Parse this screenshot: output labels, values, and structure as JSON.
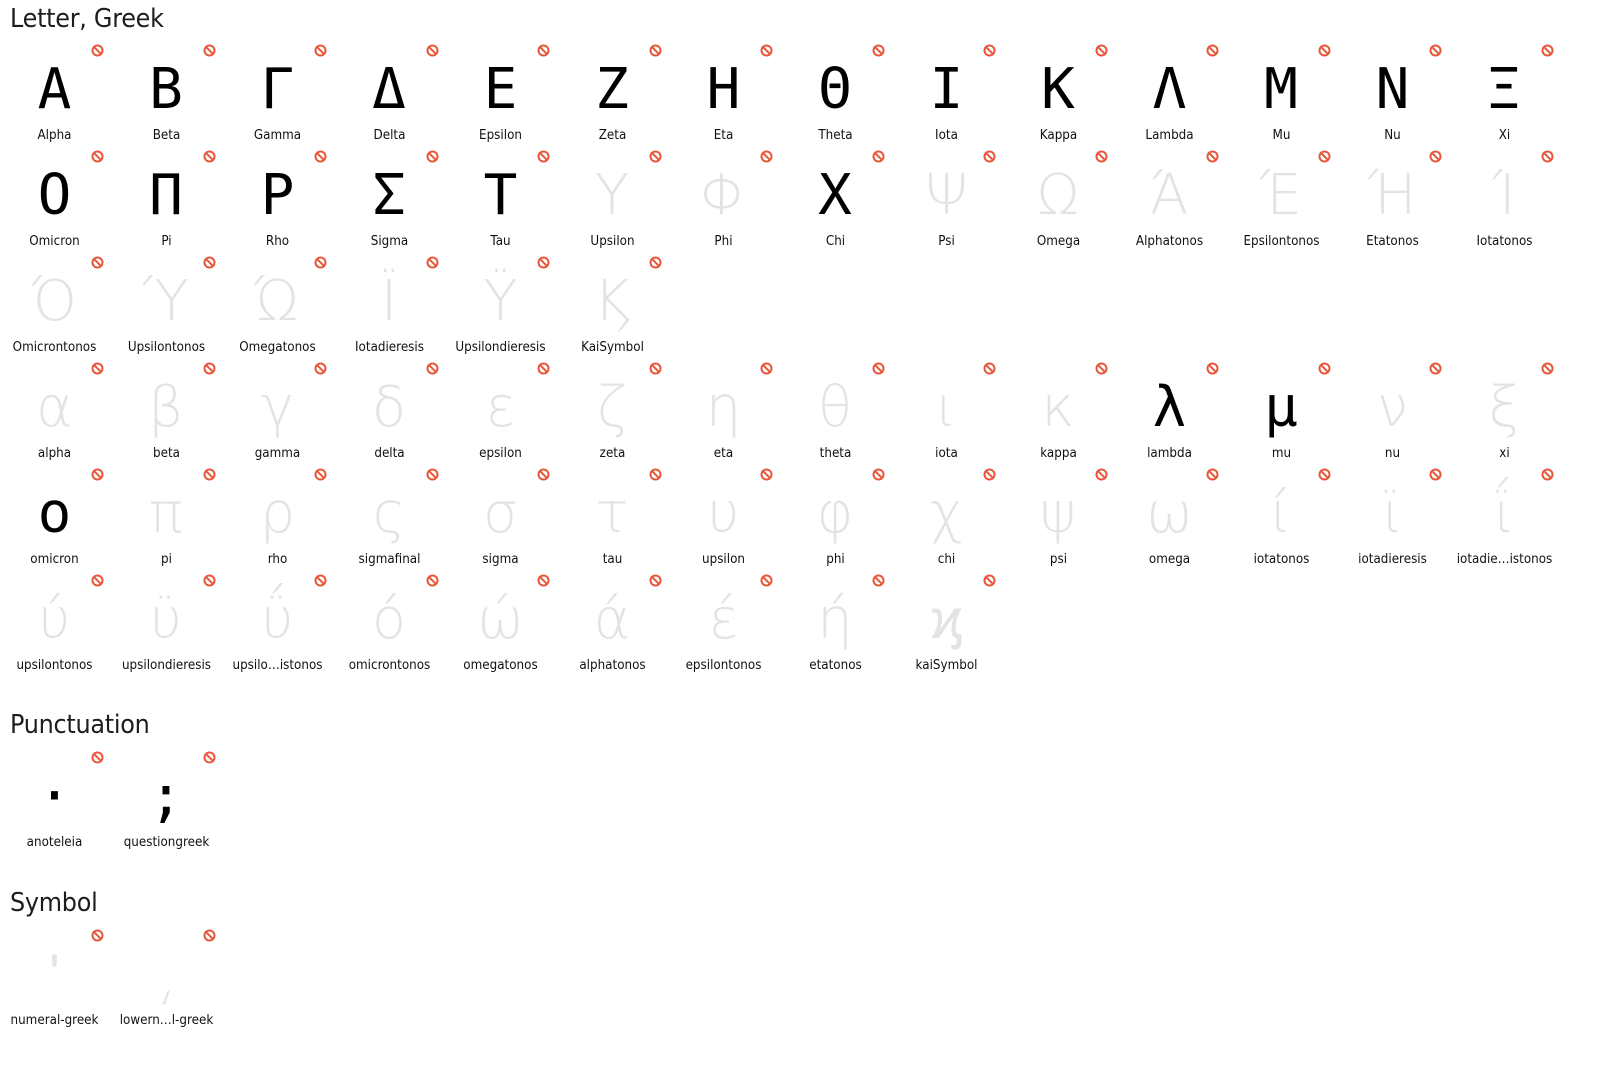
{
  "colors": {
    "missing_glyph": "#e3e3e3",
    "present_glyph": "#000000",
    "no_entry_icon": "#e8563a"
  },
  "sections": [
    {
      "title": "Letter, Greek",
      "items": [
        {
          "char": "Α",
          "name": "Alpha",
          "present": true
        },
        {
          "char": "Β",
          "name": "Beta",
          "present": true
        },
        {
          "char": "Γ",
          "name": "Gamma",
          "present": true
        },
        {
          "char": "Δ",
          "name": "Delta",
          "present": true
        },
        {
          "char": "Ε",
          "name": "Epsilon",
          "present": true
        },
        {
          "char": "Ζ",
          "name": "Zeta",
          "present": true
        },
        {
          "char": "Η",
          "name": "Eta",
          "present": true
        },
        {
          "char": "Θ",
          "name": "Theta",
          "present": true
        },
        {
          "char": "Ι",
          "name": "Iota",
          "present": true
        },
        {
          "char": "Κ",
          "name": "Kappa",
          "present": true
        },
        {
          "char": "Λ",
          "name": "Lambda",
          "present": true
        },
        {
          "char": "Μ",
          "name": "Mu",
          "present": true
        },
        {
          "char": "Ν",
          "name": "Nu",
          "present": true
        },
        {
          "char": "Ξ",
          "name": "Xi",
          "present": true
        },
        {
          "char": "Ο",
          "name": "Omicron",
          "present": true
        },
        {
          "char": "Π",
          "name": "Pi",
          "present": true
        },
        {
          "char": "Ρ",
          "name": "Rho",
          "present": true
        },
        {
          "char": "Σ",
          "name": "Sigma",
          "present": true
        },
        {
          "char": "Τ",
          "name": "Tau",
          "present": true
        },
        {
          "char": "Υ",
          "name": "Upsilon",
          "present": false
        },
        {
          "char": "Φ",
          "name": "Phi",
          "present": false
        },
        {
          "char": "Χ",
          "name": "Chi",
          "present": true
        },
        {
          "char": "Ψ",
          "name": "Psi",
          "present": false
        },
        {
          "char": "Ω",
          "name": "Omega",
          "present": false
        },
        {
          "char": "Ά",
          "name": "Alphatonos",
          "present": false
        },
        {
          "char": "Έ",
          "name": "Epsilontonos",
          "present": false
        },
        {
          "char": "Ή",
          "name": "Etatonos",
          "present": false
        },
        {
          "char": "Ί",
          "name": "Iotatonos",
          "present": false
        },
        {
          "char": "Ό",
          "name": "Omicrontonos",
          "present": false
        },
        {
          "char": "Ύ",
          "name": "Upsilontonos",
          "present": false
        },
        {
          "char": "Ώ",
          "name": "Omegatonos",
          "present": false
        },
        {
          "char": "Ϊ",
          "name": "Iotadieresis",
          "present": false
        },
        {
          "char": "Ϋ",
          "name": "Upsilondieresis",
          "present": false
        },
        {
          "char": "Ϗ",
          "name": "KaiSymbol",
          "present": false
        },
        {
          "break": true
        },
        {
          "char": "α",
          "name": "alpha",
          "present": false
        },
        {
          "char": "β",
          "name": "beta",
          "present": false
        },
        {
          "char": "γ",
          "name": "gamma",
          "present": false
        },
        {
          "char": "δ",
          "name": "delta",
          "present": false
        },
        {
          "char": "ε",
          "name": "epsilon",
          "present": false
        },
        {
          "char": "ζ",
          "name": "zeta",
          "present": false
        },
        {
          "char": "η",
          "name": "eta",
          "present": false
        },
        {
          "char": "θ",
          "name": "theta",
          "present": false
        },
        {
          "char": "ι",
          "name": "iota",
          "present": false
        },
        {
          "char": "κ",
          "name": "kappa",
          "present": false
        },
        {
          "char": "λ",
          "name": "lambda",
          "present": true
        },
        {
          "char": "μ",
          "name": "mu",
          "present": true
        },
        {
          "char": "ν",
          "name": "nu",
          "present": false
        },
        {
          "char": "ξ",
          "name": "xi",
          "present": false
        },
        {
          "char": "ο",
          "name": "omicron",
          "present": true
        },
        {
          "char": "π",
          "name": "pi",
          "present": false
        },
        {
          "char": "ρ",
          "name": "rho",
          "present": false
        },
        {
          "char": "ς",
          "name": "sigmafinal",
          "present": false
        },
        {
          "char": "σ",
          "name": "sigma",
          "present": false
        },
        {
          "char": "τ",
          "name": "tau",
          "present": false
        },
        {
          "char": "υ",
          "name": "upsilon",
          "present": false
        },
        {
          "char": "φ",
          "name": "phi",
          "present": false
        },
        {
          "char": "χ",
          "name": "chi",
          "present": false
        },
        {
          "char": "ψ",
          "name": "psi",
          "present": false
        },
        {
          "char": "ω",
          "name": "omega",
          "present": false
        },
        {
          "char": "ί",
          "name": "iotatonos",
          "present": false
        },
        {
          "char": "ϊ",
          "name": "iotadieresis",
          "present": false
        },
        {
          "char": "ΐ",
          "name": "iotadie…istonos",
          "present": false
        },
        {
          "char": "ύ",
          "name": "upsilontonos",
          "present": false
        },
        {
          "char": "ϋ",
          "name": "upsilondieresis",
          "present": false
        },
        {
          "char": "ΰ",
          "name": "upsilo…istonos",
          "present": false
        },
        {
          "char": "ό",
          "name": "omicrontonos",
          "present": false
        },
        {
          "char": "ώ",
          "name": "omegatonos",
          "present": false
        },
        {
          "char": "ά",
          "name": "alphatonos",
          "present": false
        },
        {
          "char": "έ",
          "name": "epsilontonos",
          "present": false
        },
        {
          "char": "ή",
          "name": "etatonos",
          "present": false
        },
        {
          "char": "ϗ",
          "name": "kaiSymbol",
          "present": false
        }
      ]
    },
    {
      "title": "Punctuation",
      "items": [
        {
          "char": "·",
          "name": "anoteleia",
          "present": true
        },
        {
          "char": ";",
          "name": "questiongreek",
          "present": true
        }
      ]
    },
    {
      "title": "Symbol",
      "items": [
        {
          "char": "ʹ",
          "name": "numeral-greek",
          "present": false
        },
        {
          "char": "͵",
          "name": "lowern…l-greek",
          "present": false
        }
      ]
    }
  ]
}
